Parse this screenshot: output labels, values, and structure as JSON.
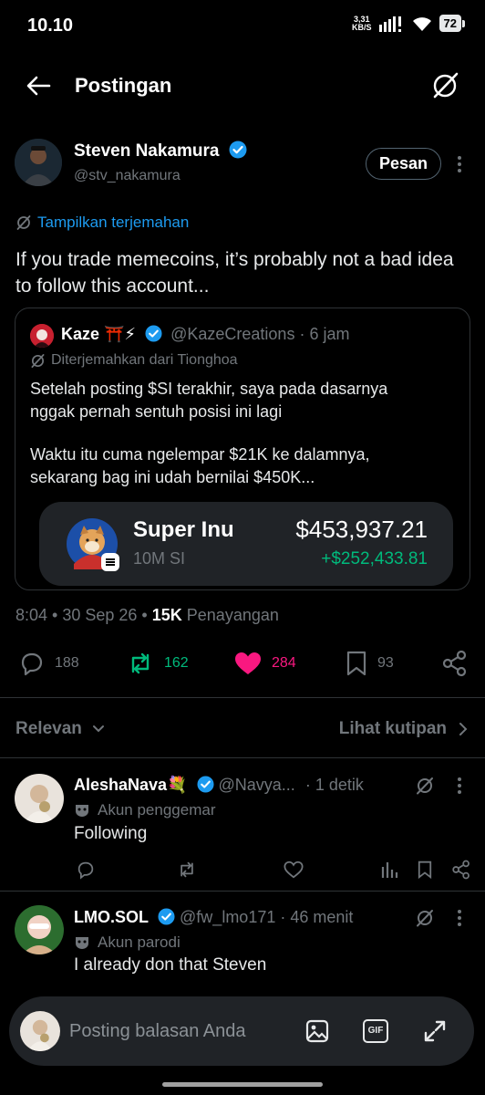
{
  "status_bar": {
    "time": "10.10",
    "speed_value": "3,31",
    "speed_unit": "KB/S",
    "battery": "72"
  },
  "header": {
    "title": "Postingan"
  },
  "post": {
    "author_name": "Steven Nakamura",
    "author_handle": "@stv_nakamura",
    "message_button": "Pesan",
    "translate_link": "Tampilkan terjemahan",
    "text": "If you trade memecoins, it’s probably not a bad idea to follow this account...",
    "meta_time": "8:04 • 30 Sep 26 •",
    "views_count": "15K",
    "views_label": "Penayangan",
    "quote": {
      "author_name": "Kaze ⛩️⚡",
      "author_handle": "@KazeCreations",
      "time": "· 6 jam",
      "translated_label": "Diterjemahkan dari Tionghoa",
      "text_line1": "Setelah posting $SI terakhir, saya pada dasarnya",
      "text_line2": "nggak pernah sentuh posisi ini lagi",
      "text_line3": "Waktu itu cuma ngelempar $21K ke dalamnya,",
      "text_line4": "sekarang bag ini udah bernilai $450K...",
      "token": {
        "name": "Super Inu",
        "amount": "10M SI",
        "value": "$453,937.21",
        "change": "+$252,433.81",
        "change_color": "#00ba7c"
      }
    },
    "actions": {
      "replies": "188",
      "reposts": "162",
      "likes": "284",
      "bookmarks": "93"
    }
  },
  "filter": {
    "sort_label": "Relevan",
    "quotes_label": "Lihat kutipan"
  },
  "replies": [
    {
      "name": "AleshaNava💐",
      "handle": "@Navya...",
      "time": "· 1 detik",
      "badge": "Akun penggemar",
      "text": "Following"
    },
    {
      "name": "LMO.SOL",
      "handle": "@fw_lmo171",
      "time": "· 46 menit",
      "badge": "Akun parodi",
      "text": "I already don that Steven"
    }
  ],
  "reply_bar": {
    "placeholder": "Posting balasan Anda",
    "gif_label": "GIF"
  },
  "colors": {
    "accent": "#1d9bf0",
    "like": "#f91880",
    "repost": "#00ba7c",
    "muted": "#71767b"
  }
}
